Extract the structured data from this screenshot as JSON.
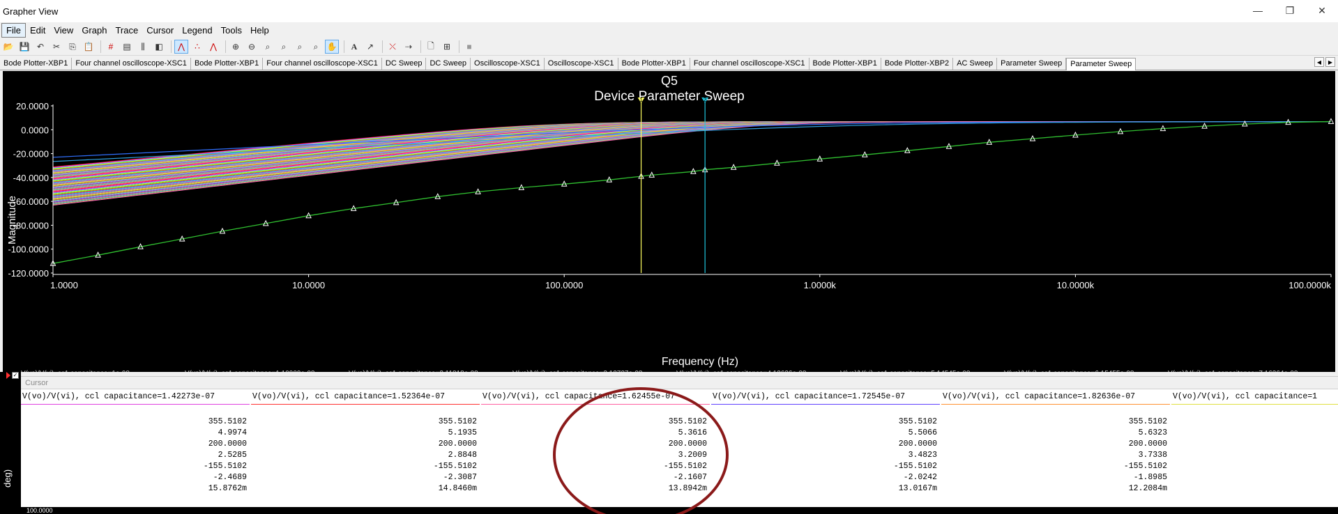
{
  "window": {
    "title": "Grapher View",
    "controls": {
      "minimize": "—",
      "maximize": "❐",
      "close": "✕"
    }
  },
  "menu": [
    "File",
    "Edit",
    "View",
    "Graph",
    "Trace",
    "Cursor",
    "Legend",
    "Tools",
    "Help"
  ],
  "tabs": [
    "Bode Plotter-XBP1",
    "Four channel oscilloscope-XSC1",
    "Bode Plotter-XBP1",
    "Four channel oscilloscope-XSC1",
    "DC Sweep",
    "DC Sweep",
    "Oscilloscope-XSC1",
    "Oscilloscope-XSC1",
    "Bode Plotter-XBP1",
    "Four channel oscilloscope-XSC1",
    "Bode Plotter-XBP1",
    "Bode Plotter-XBP2",
    "AC Sweep",
    "Parameter Sweep",
    "Parameter Sweep"
  ],
  "active_tab_index": 14,
  "graph": {
    "subtitle": "Q5",
    "title": "Device Parameter Sweep"
  },
  "chart_data": {
    "type": "line",
    "title": "Device Parameter Sweep",
    "subtitle": "Q5",
    "xlabel": "Frequency (Hz)",
    "ylabel": "Magnitude",
    "xscale": "log",
    "xlim": [
      1,
      100000
    ],
    "ylim": [
      -120,
      20
    ],
    "x_ticks": [
      "1.0000",
      "10.0000",
      "100.0000",
      "1.0000k",
      "10.0000k",
      "100.0000k"
    ],
    "y_ticks": [
      "20.0000",
      "0.0000",
      "-20.0000",
      "-40.0000",
      "-60.0000",
      "-80.0000",
      "-100.0000",
      "-120.0000"
    ],
    "grid": false,
    "cursors": [
      {
        "name": "1",
        "x": 200,
        "color": "#ffff60"
      },
      {
        "name": "2",
        "x": 355.5102,
        "color": "#20c8e0"
      }
    ],
    "series_colors": [
      "#ff2020",
      "#ff40ff",
      "#40a0ff",
      "#ffff40",
      "#40ff40",
      "#ff8000",
      "#a040ff",
      "#00ffff",
      "#ff6090",
      "#8080ff",
      "#ffc040",
      "#c0ff40",
      "#ff4040",
      "#40ffc0",
      "#e070e0",
      "#6060ff",
      "#ff9050",
      "#40c0ff",
      "#c0c040",
      "#ff60c0"
    ],
    "series_summary": "Parametric family of magnitude curves: each curve starts between about -52 and -90 at 1 Hz and rises toward about 6-7 at high frequency; the highlighted green trace starts near -112 at 1 Hz and reaches about 6.9 at 100 kHz.",
    "highlight_series": {
      "color": "#30c030",
      "x": [
        1,
        1.5,
        2.2,
        3.2,
        4.6,
        6.8,
        10,
        15,
        22,
        32,
        46,
        68,
        100,
        150,
        200,
        220,
        320,
        355.5,
        460,
        680,
        1000,
        1500,
        2200,
        3200,
        4600,
        6800,
        10000,
        15000,
        22000,
        32000,
        46000,
        68000,
        100000
      ],
      "y": [
        -112,
        -105,
        -98,
        -91.5,
        -85,
        -78.5,
        -72,
        -66,
        -61,
        -56,
        -52,
        -48.5,
        -45.5,
        -42,
        -39,
        -38,
        -35,
        -33.5,
        -31.5,
        -28,
        -24.5,
        -21,
        -17.5,
        -14,
        -10.5,
        -7.5,
        -4.5,
        -1.5,
        1,
        3,
        4.8,
        6.2,
        6.9
      ]
    }
  },
  "legend_faint": [
    "V(vo)/V(vi), cc1 capacitance=1e-08",
    "V(vo)/V(vi), cc1 capacitance=1.10909e-08",
    "V(vo)/V(vi), cc1 capacitance=2.11818e-08",
    "V(vo)/V(vi), cc1 capacitance=3.12727e-08",
    "V(vo)/V(vi), cc1 capacitance=4.13636e-08",
    "V(vo)/V(vi), cc1 capacitance=5.14545e-08",
    "V(vo)/V(vi), cc1 capacitance=6.15455e-08",
    "V(vo)/V(vi), cc1 capacitance=7.16364e-08"
  ],
  "cursor_panel": {
    "title": "Cursor",
    "columns": [
      {
        "header": "V(vo)/V(vi), ccl capacitance=1.42273e-07",
        "color": "#e040e0",
        "values": [
          "355.5102",
          "4.9974",
          "200.0000",
          "2.5285",
          "-155.5102",
          "-2.4689",
          "15.8762m"
        ]
      },
      {
        "header": "V(vo)/V(vi), ccl capacitance=1.52364e-07",
        "color": "#ff3030",
        "values": [
          "355.5102",
          "5.1935",
          "200.0000",
          "2.8848",
          "-155.5102",
          "-2.3087",
          "14.8460m"
        ]
      },
      {
        "header": "V(vo)/V(vi), ccl capacitance=1.62455e-07",
        "color": "#ff60a0",
        "values": [
          "355.5102",
          "5.3616",
          "200.0000",
          "3.2009",
          "-155.5102",
          "-2.1607",
          "13.8942m"
        ]
      },
      {
        "header": "V(vo)/V(vi), ccl capacitance=1.72545e-07",
        "color": "#6040ff",
        "values": [
          "355.5102",
          "5.5066",
          "200.0000",
          "3.4823",
          "-155.5102",
          "-2.0242",
          "13.0167m"
        ]
      },
      {
        "header": "V(vo)/V(vi), ccl capacitance=1.82636e-07",
        "color": "#ff9030",
        "values": [
          "355.5102",
          "5.6323",
          "200.0000",
          "3.7338",
          "-155.5102",
          "-1.8985",
          "12.2084m"
        ]
      },
      {
        "header": "V(vo)/V(vi), ccl capacitance=1",
        "color": "#e0e040",
        "values": []
      }
    ]
  },
  "bottom_axis": {
    "label": "deg)",
    "tick": "100.0000"
  },
  "icons": [
    "open-icon",
    "save-icon",
    "undo-icon",
    "cut-icon",
    "copy-icon",
    "paste-icon",
    "grid-icon",
    "legend-icon",
    "cursors-icon",
    "reverse-colors-icon",
    "trace-icon",
    "zoom-in-icon",
    "zoom-out-icon",
    "pan-icon",
    "text-icon",
    "export-icon"
  ]
}
